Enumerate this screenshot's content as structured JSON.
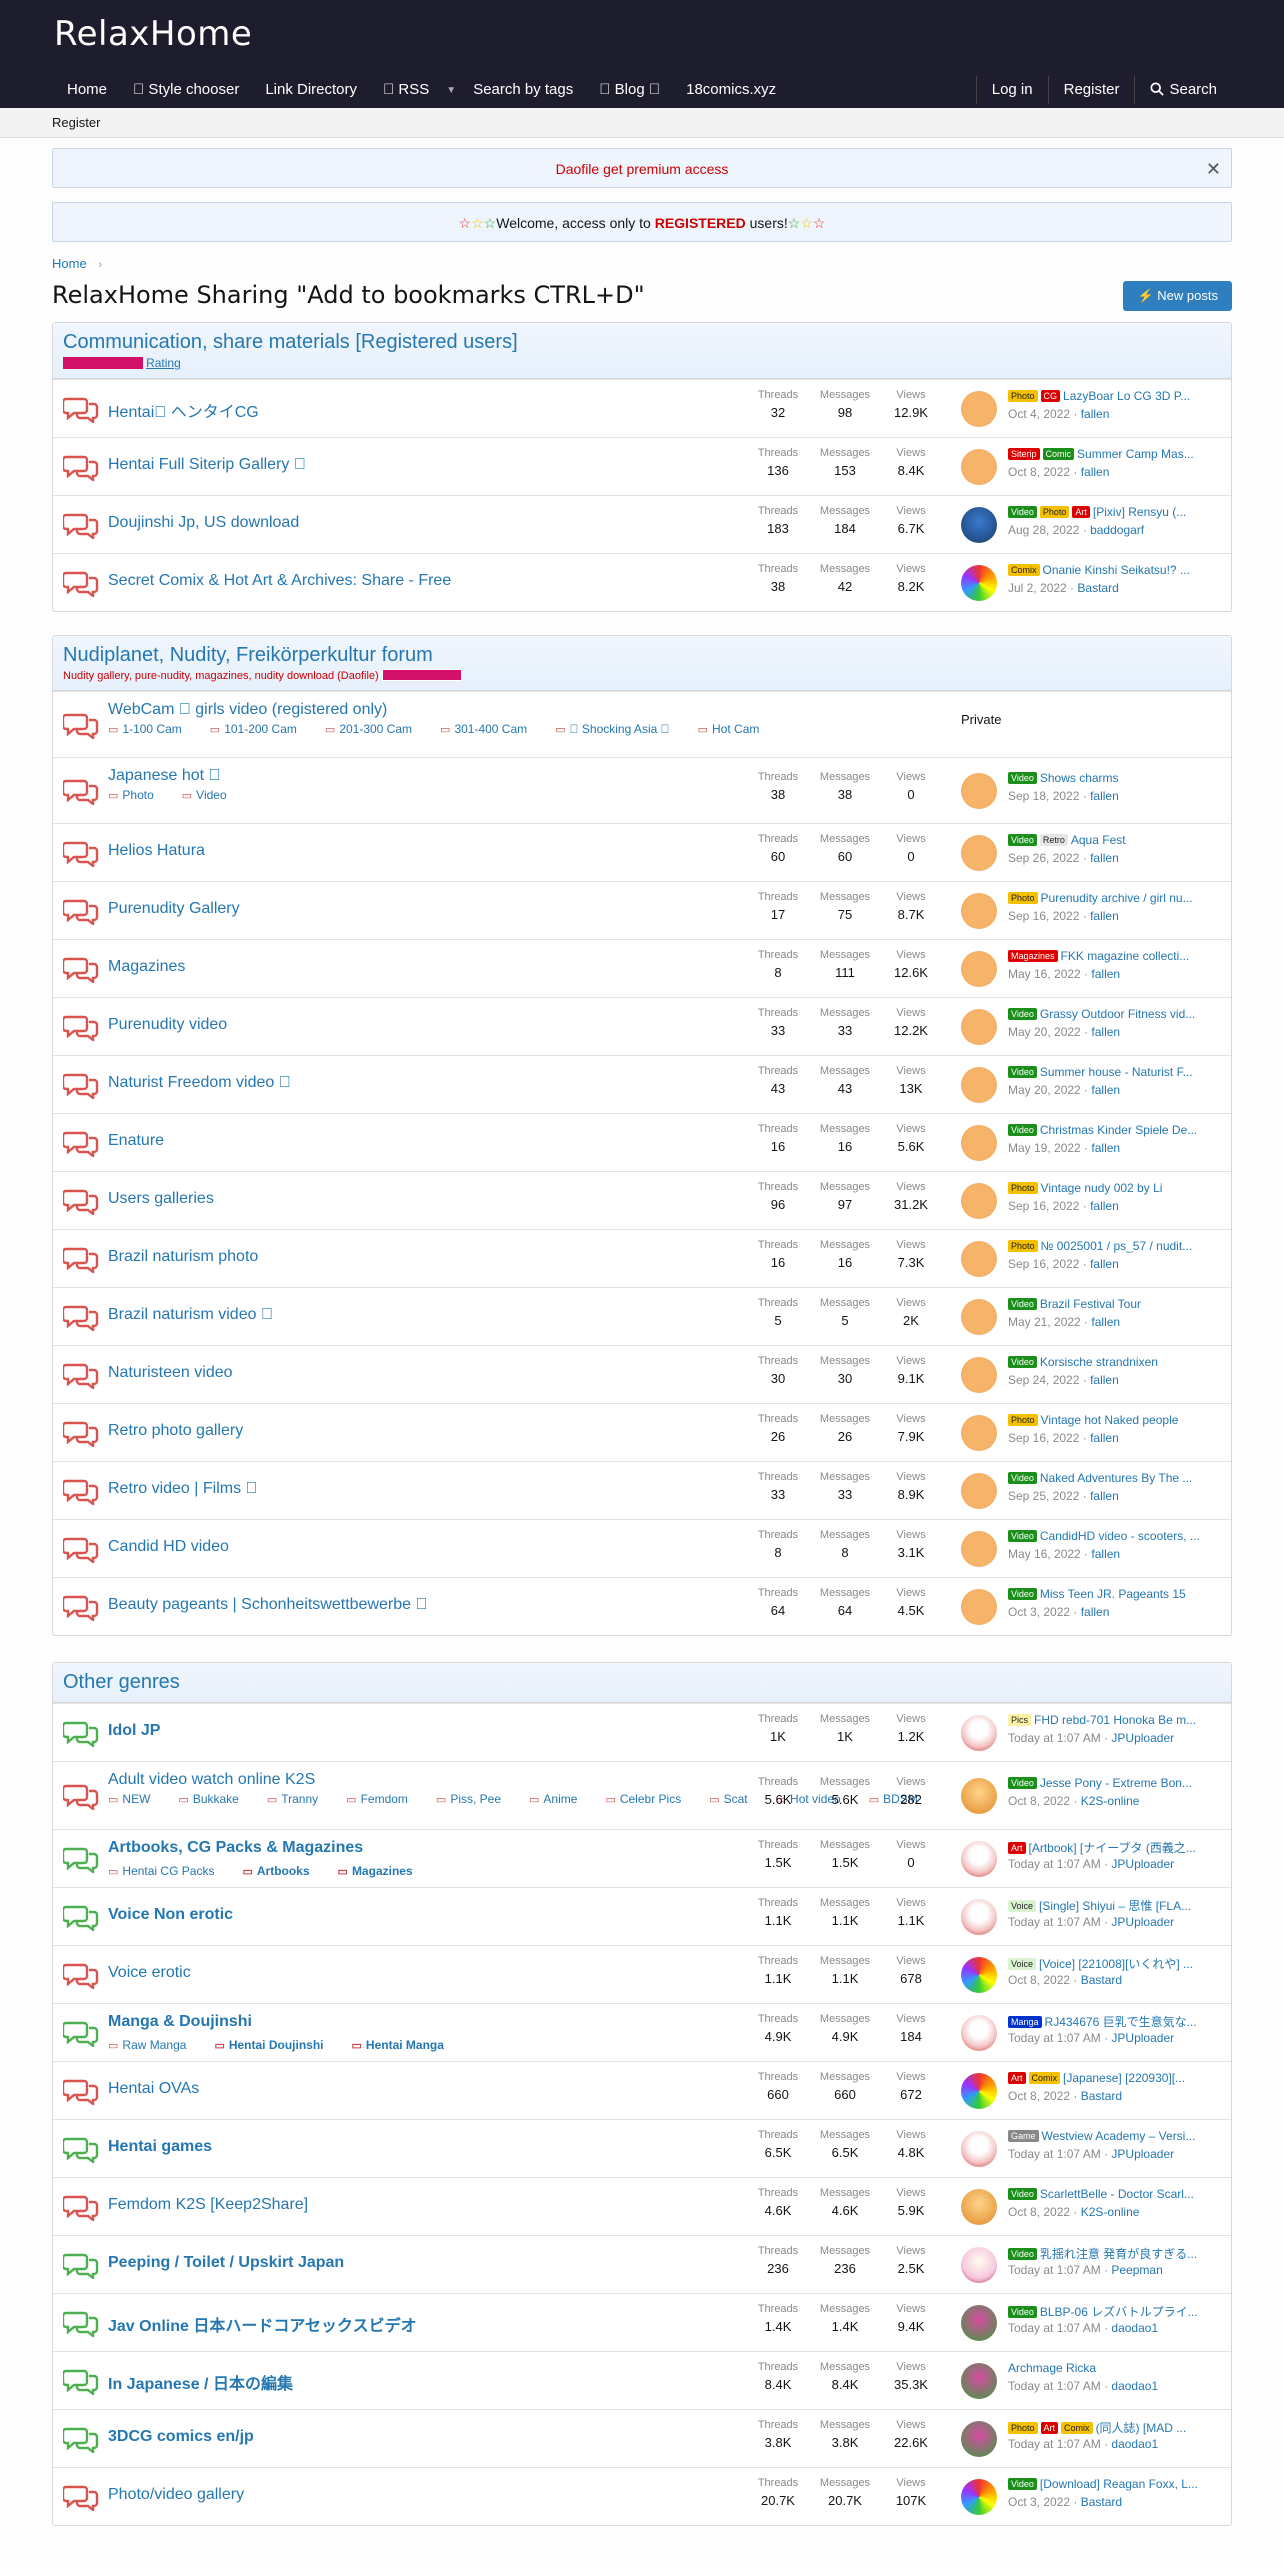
{
  "site": {
    "logo": "RelaxHome"
  },
  "nav": {
    "home": "Home",
    "style": "\u0000 Style chooser",
    "links": "Link Directory",
    "rss": "\u0000 RSS",
    "tags": "Search by tags",
    "blog": "\u0000 Blog \u0000",
    "comics": "18comics.xyz",
    "login": "Log in",
    "register": "Register",
    "search": "Search"
  },
  "subnav": {
    "register": "Register"
  },
  "notices": {
    "premium": "Daofile get premium access",
    "welcome_pre": "Welcome, access only to ",
    "welcome_reg": "REGISTERED",
    "welcome_post": " users!"
  },
  "breadcrumb": "Home",
  "page_title": "RelaxHome Sharing \"Add to bookmarks CTRL+D\"",
  "new_posts": "New posts",
  "stat_labels": {
    "threads": "Threads",
    "messages": "Messages",
    "views": "Views"
  },
  "sections": [
    {
      "title": "Communication, share materials [Registered users]",
      "desc": "",
      "badge": "Rating",
      "forums": [
        {
          "title": "Hentai\u0000 ヘンタイCG",
          "bold": false,
          "threads": "32",
          "messages": "98",
          "views": "12.9K",
          "labels": [
            [
              "Photo",
              "photo"
            ],
            [
              "CG",
              "cg"
            ]
          ],
          "last": "LazyBoar Lo CG 3D P...",
          "date": "Oct 4, 2022",
          "user": "fallen",
          "av": "av1"
        },
        {
          "title": "Hentai Full Siterip Gallery \u0000",
          "bold": false,
          "threads": "136",
          "messages": "153",
          "views": "8.4K",
          "labels": [
            [
              "Siterip",
              "siterip"
            ],
            [
              "Comic",
              "comic"
            ]
          ],
          "last": "Summer Camp Mas...",
          "date": "Oct 8, 2022",
          "user": "fallen",
          "av": "av1"
        },
        {
          "title": "Doujinshi Jp, US download",
          "bold": false,
          "threads": "183",
          "messages": "184",
          "views": "6.7K",
          "labels": [
            [
              "Video",
              "video"
            ],
            [
              "Photo",
              "photo"
            ],
            [
              "Art",
              "art"
            ]
          ],
          "last": "[Pixiv] Rensyu (...",
          "date": "Aug 28, 2022",
          "user": "baddogarf",
          "av": "av2"
        },
        {
          "title": "Secret Comix & Hot Art & Archives: Share - Free",
          "bold": false,
          "threads": "38",
          "messages": "42",
          "views": "8.2K",
          "labels": [
            [
              "Comix",
              "comicy"
            ]
          ],
          "last": "Onanie Kinshi Seikatsu!? ...",
          "date": "Jul 2, 2022",
          "user": "Bastard",
          "av": "av3"
        }
      ]
    },
    {
      "title": "Nudiplanet, Nudity, Freikörperkultur forum",
      "desc": "Nudity gallery, pure-nudity, magazines, nudity download (Daofile)",
      "badge": "",
      "forums": [
        {
          "title": "WebCam \u0000 girls video (registered only)",
          "bold": false,
          "private": "Private",
          "subs": [
            "1-100 Cam",
            "101-200 Cam",
            "201-300 Cam",
            "301-400 Cam",
            "\u0000 Shocking Asia \u0000",
            "Hot Cam"
          ]
        },
        {
          "title": "Japanese hot \u0000",
          "bold": false,
          "threads": "38",
          "messages": "38",
          "views": "0",
          "labels": [
            [
              "Video",
              "video"
            ]
          ],
          "last": "Shows charms",
          "date": "Sep 18, 2022",
          "user": "fallen",
          "av": "av1",
          "subs": [
            "Photo",
            "Video"
          ]
        },
        {
          "title": "Helios Hatura",
          "bold": false,
          "threads": "60",
          "messages": "60",
          "views": "0",
          "labels": [
            [
              "Video",
              "video"
            ],
            [
              "Retro",
              "retro"
            ]
          ],
          "last": "Aqua Fest",
          "date": "Sep 26, 2022",
          "user": "fallen",
          "av": "av1"
        },
        {
          "title": "Purenudity Gallery",
          "bold": false,
          "threads": "17",
          "messages": "75",
          "views": "8.7K",
          "labels": [
            [
              "Photo",
              "photo"
            ]
          ],
          "last": "Purenudity archive / girl nu...",
          "date": "Sep 16, 2022",
          "user": "fallen",
          "av": "av1"
        },
        {
          "title": "Magazines",
          "bold": false,
          "threads": "8",
          "messages": "111",
          "views": "12.6K",
          "labels": [
            [
              "Magazines",
              "mag"
            ]
          ],
          "last": "FKK magazine collecti...",
          "date": "May 16, 2022",
          "user": "fallen",
          "av": "av1"
        },
        {
          "title": "Purenudity video",
          "bold": false,
          "threads": "33",
          "messages": "33",
          "views": "12.2K",
          "labels": [
            [
              "Video",
              "video"
            ]
          ],
          "last": "Grassy Outdoor Fitness vid...",
          "date": "May 20, 2022",
          "user": "fallen",
          "av": "av1"
        },
        {
          "title": "Naturist Freedom video \u0000",
          "bold": false,
          "threads": "43",
          "messages": "43",
          "views": "13K",
          "labels": [
            [
              "Video",
              "video"
            ]
          ],
          "last": "Summer house - Naturist F...",
          "date": "May 20, 2022",
          "user": "fallen",
          "av": "av1"
        },
        {
          "title": "Enature",
          "bold": false,
          "threads": "16",
          "messages": "16",
          "views": "5.6K",
          "labels": [
            [
              "Video",
              "video"
            ]
          ],
          "last": "Christmas Kinder Spiele De...",
          "date": "May 19, 2022",
          "user": "fallen",
          "av": "av1"
        },
        {
          "title": "Users galleries",
          "bold": false,
          "threads": "96",
          "messages": "97",
          "views": "31.2K",
          "labels": [
            [
              "Photo",
              "photo"
            ]
          ],
          "last": "Vintage nudy 002 by Li",
          "date": "Sep 16, 2022",
          "user": "fallen",
          "av": "av1"
        },
        {
          "title": "Brazil naturism photo",
          "bold": false,
          "threads": "16",
          "messages": "16",
          "views": "7.3K",
          "labels": [
            [
              "Photo",
              "photo"
            ]
          ],
          "last": "№ 0025001 / ps_57 / nudit...",
          "date": "Sep 16, 2022",
          "user": "fallen",
          "av": "av1"
        },
        {
          "title": "Brazil naturism video \u0000",
          "bold": false,
          "threads": "5",
          "messages": "5",
          "views": "2K",
          "labels": [
            [
              "Video",
              "video"
            ]
          ],
          "last": "Brazil Festival Tour",
          "date": "May 21, 2022",
          "user": "fallen",
          "av": "av1"
        },
        {
          "title": "Naturisteen video",
          "bold": false,
          "threads": "30",
          "messages": "30",
          "views": "9.1K",
          "labels": [
            [
              "Video",
              "video"
            ]
          ],
          "last": "Korsische strandnixen",
          "date": "Sep 24, 2022",
          "user": "fallen",
          "av": "av1"
        },
        {
          "title": "Retro photo gallery",
          "bold": false,
          "threads": "26",
          "messages": "26",
          "views": "7.9K",
          "labels": [
            [
              "Photo",
              "photo"
            ]
          ],
          "last": "Vintage hot Naked people",
          "date": "Sep 16, 2022",
          "user": "fallen",
          "av": "av1"
        },
        {
          "title": "Retro video | Films \u0000",
          "bold": false,
          "threads": "33",
          "messages": "33",
          "views": "8.9K",
          "labels": [
            [
              "Video",
              "video"
            ]
          ],
          "last": "Naked Adventures By The ...",
          "date": "Sep 25, 2022",
          "user": "fallen",
          "av": "av1"
        },
        {
          "title": "Candid HD video",
          "bold": false,
          "threads": "8",
          "messages": "8",
          "views": "3.1K",
          "labels": [
            [
              "Video",
              "video"
            ]
          ],
          "last": "CandidHD video - scooters, ...",
          "date": "May 16, 2022",
          "user": "fallen",
          "av": "av1"
        },
        {
          "title": "Beauty pageants | Schonheitswettbewerbe \u0000",
          "bold": false,
          "threads": "64",
          "messages": "64",
          "views": "4.5K",
          "labels": [
            [
              "Video",
              "video"
            ]
          ],
          "last": "Miss Teen JR. Pageants 15",
          "date": "Oct 3, 2022",
          "user": "fallen",
          "av": "av1"
        }
      ]
    },
    {
      "title": "Other genres",
      "desc": "",
      "badge": "",
      "forums": [
        {
          "title": "Idol JP",
          "bold": true,
          "threads": "1K",
          "messages": "1K",
          "views": "1.2K",
          "labels": [
            [
              "Pics",
              "pics"
            ]
          ],
          "last": "FHD rebd-701 Honoka Be m...",
          "date": "Today at 1:07 AM",
          "user": "JPUploader",
          "av": "av4"
        },
        {
          "title": "Adult video watch online K2S",
          "bold": false,
          "threads": "5.6K",
          "messages": "5.6K",
          "views": "282",
          "labels": [
            [
              "Video",
              "video"
            ]
          ],
          "last": "Jesse Pony - Extreme Bon...",
          "date": "Oct 8, 2022",
          "user": "K2S-online",
          "av": "av5",
          "subs": [
            "NEW",
            "Bukkake",
            "Tranny",
            "Femdom",
            "Piss, Pee",
            "Anime",
            "Celebr Pics",
            "Scat",
            "Hot video",
            "BDSM"
          ]
        },
        {
          "title": "Artbooks, CG Packs & Magazines",
          "bold": true,
          "threads": "1.5K",
          "messages": "1.5K",
          "views": "0",
          "labels": [
            [
              "Art",
              "art"
            ]
          ],
          "last": "[Artbook] [ナイーブタ (西義之...",
          "date": "Today at 1:07 AM",
          "user": "JPUploader",
          "av": "av4",
          "subs": [
            "Hentai CG Packs",
            "Artbooks",
            "Magazines"
          ]
        },
        {
          "title": "Voice Non erotic",
          "bold": true,
          "threads": "1.1K",
          "messages": "1.1K",
          "views": "1.1K",
          "labels": [
            [
              "Voice",
              "voice"
            ]
          ],
          "last": "[Single] Shiyui – 思惟 [FLA...",
          "date": "Today at 1:07 AM",
          "user": "JPUploader",
          "av": "av4"
        },
        {
          "title": "Voice erotic",
          "bold": false,
          "threads": "1.1K",
          "messages": "1.1K",
          "views": "678",
          "labels": [
            [
              "Voice",
              "voice"
            ]
          ],
          "last": "[Voice] [221008][いくれや] ...",
          "date": "Oct 8, 2022",
          "user": "Bastard",
          "av": "av3"
        },
        {
          "title": "Manga & Doujinshi",
          "bold": true,
          "threads": "4.9K",
          "messages": "4.9K",
          "views": "184",
          "labels": [
            [
              "Manga",
              "manga"
            ]
          ],
          "last": "RJ434676 巨乳で生意気な...",
          "date": "Today at 1:07 AM",
          "user": "JPUploader",
          "av": "av4",
          "subs": [
            "Raw Manga",
            "Hentai Doujinshi",
            "Hentai Manga"
          ]
        },
        {
          "title": "Hentai OVAs",
          "bold": false,
          "threads": "660",
          "messages": "660",
          "views": "672",
          "labels": [
            [
              "Art",
              "art"
            ],
            [
              "Comix",
              "comicy"
            ]
          ],
          "last": "[Japanese] [220930][...",
          "date": "Oct 8, 2022",
          "user": "Bastard",
          "av": "av3"
        },
        {
          "title": "Hentai games",
          "bold": true,
          "threads": "6.5K",
          "messages": "6.5K",
          "views": "4.8K",
          "labels": [
            [
              "Game",
              "game"
            ]
          ],
          "last": "Westview Academy – Versi...",
          "date": "Today at 1:07 AM",
          "user": "JPUploader",
          "av": "av4"
        },
        {
          "title": "Femdom K2S [Keep2Share]",
          "bold": false,
          "threads": "4.6K",
          "messages": "4.6K",
          "views": "5.9K",
          "labels": [
            [
              "Video",
              "video"
            ]
          ],
          "last": "ScarlettBelle - Doctor Scarl...",
          "date": "Oct 8, 2022",
          "user": "K2S-online",
          "av": "av5"
        },
        {
          "title": "Peeping / Toilet / Upskirt Japan",
          "bold": true,
          "threads": "236",
          "messages": "236",
          "views": "2.5K",
          "labels": [
            [
              "Video",
              "video"
            ]
          ],
          "last": "乳揺れ注意 発育が良すぎる...",
          "date": "Today at 1:07 AM",
          "user": "Peepman",
          "av": "av6"
        },
        {
          "title": "Jav Online 日本ハードコアセックスビデオ",
          "bold": true,
          "threads": "1.4K",
          "messages": "1.4K",
          "views": "9.4K",
          "labels": [
            [
              "Video",
              "video"
            ]
          ],
          "last": "BLBP-06 レズバトルプライ...",
          "date": "Today at 1:07 AM",
          "user": "daodao1",
          "av": "av7"
        },
        {
          "title": "In Japanese / 日本の編集",
          "bold": true,
          "threads": "8.4K",
          "messages": "8.4K",
          "views": "35.3K",
          "labels": [],
          "last": "Archmage Ricka",
          "date": "Today at 1:07 AM",
          "user": "daodao1",
          "av": "av7"
        },
        {
          "title": "3DCG comics en/jp",
          "bold": true,
          "threads": "3.8K",
          "messages": "3.8K",
          "views": "22.6K",
          "labels": [
            [
              "Photo",
              "photo"
            ],
            [
              "Art",
              "art"
            ],
            [
              "Comix",
              "comicy"
            ]
          ],
          "last": "(同人誌) [MAD ...",
          "date": "Today at 1:07 AM",
          "user": "daodao1",
          "av": "av7"
        },
        {
          "title": "Photo/video gallery",
          "bold": false,
          "threads": "20.7K",
          "messages": "20.7K",
          "views": "107K",
          "labels": [
            [
              "Video",
              "video"
            ]
          ],
          "last": "[Download] Reagan Foxx, L...",
          "date": "Oct 3, 2022",
          "user": "Bastard",
          "av": "av3"
        }
      ]
    }
  ],
  "colors": {
    "header": "#1d1d2d",
    "link": "#2577b1",
    "unread_icon": "#4caf50",
    "read_icon": "#d9534f"
  }
}
